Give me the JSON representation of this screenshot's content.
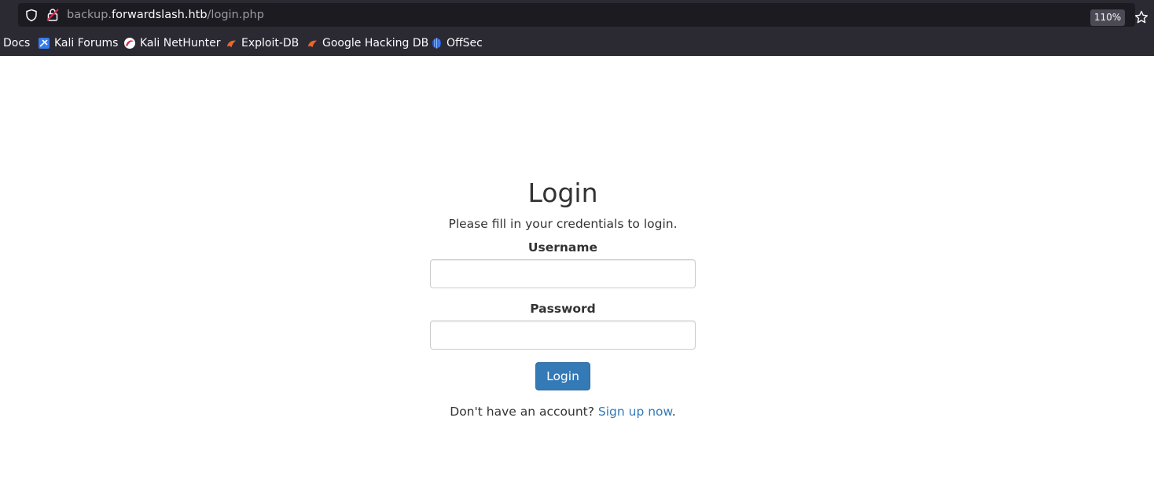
{
  "browser": {
    "url_prefix": "backup.",
    "url_host": "forwardslash.htb",
    "url_path": "/login.php",
    "zoom": "110%",
    "bookmarks": [
      {
        "label": "Docs",
        "icon": "none"
      },
      {
        "label": "Kali Forums",
        "icon": "kali-forums-icon"
      },
      {
        "label": "Kali NetHunter",
        "icon": "kali-nethunter-icon"
      },
      {
        "label": "Exploit-DB",
        "icon": "exploit-db-icon"
      },
      {
        "label": "Google Hacking DB",
        "icon": "google-hacking-db-icon"
      },
      {
        "label": "OffSec",
        "icon": "offsec-icon"
      }
    ]
  },
  "page": {
    "title": "Login",
    "subtitle": "Please fill in your credentials to login.",
    "username_label": "Username",
    "username_value": "",
    "password_label": "Password",
    "password_value": "",
    "login_button": "Login",
    "signup_prompt": "Don't have an account? ",
    "signup_link": "Sign up now",
    "signup_suffix": "."
  },
  "colors": {
    "accent": "#337ab7",
    "chrome_bg": "#2b2a33",
    "urlbar_bg": "#1c1b22"
  }
}
